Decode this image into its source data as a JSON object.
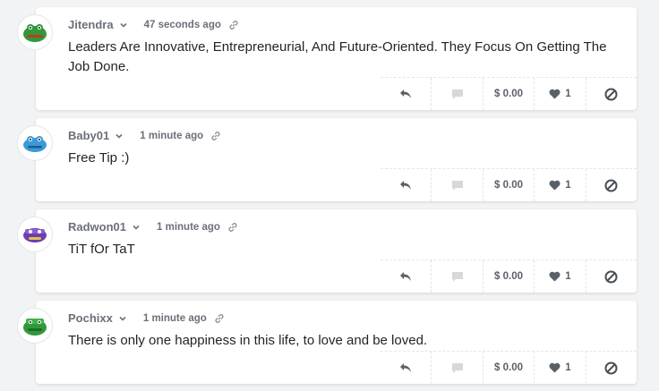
{
  "comments": [
    {
      "username": "Jitendra",
      "time": "47 seconds ago",
      "text": "Leaders Are Innovative, Entrepreneurial, And Future-Oriented. They Focus On Getting The Job Done.",
      "tip": "$ 0.00",
      "likes": "1",
      "avatar_color": "#2f9a3a"
    },
    {
      "username": "Baby01",
      "time": "1 minute ago",
      "text": "Free Tip :)",
      "tip": "$ 0.00",
      "likes": "1",
      "avatar_color": "#3a9ad9"
    },
    {
      "username": "Radwon01",
      "time": "1 minute ago",
      "text": "TiT fOr TaT",
      "tip": "$ 0.00",
      "likes": "1",
      "avatar_color": "#6b3fb0"
    },
    {
      "username": "Pochixx",
      "time": "1 minute ago",
      "text": "There is only one happiness in this life, to love and be loved.",
      "tip": "$ 0.00",
      "likes": "1",
      "avatar_color": "#2f9a3a"
    }
  ],
  "icons": {
    "reply": "reply-icon",
    "comment": "comment-icon",
    "like": "heart-icon",
    "block": "block-icon",
    "link": "link-icon",
    "dropdown": "chevron-down-icon"
  }
}
